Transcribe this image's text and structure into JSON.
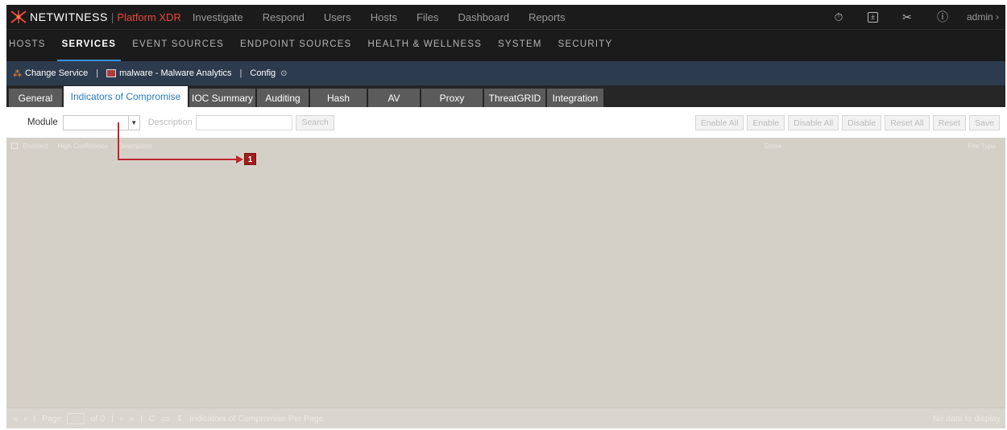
{
  "topbar": {
    "brand": "NETWITNESS",
    "platform": "Platform XDR",
    "nav": [
      "Investigate",
      "Respond",
      "Users",
      "Hosts",
      "Files",
      "Dashboard",
      "Reports"
    ],
    "icons": [
      "timer-icon",
      "calculator-icon",
      "tools-icon",
      "help-icon"
    ],
    "user": "admin"
  },
  "secnav": {
    "items": [
      "HOSTS",
      "SERVICES",
      "EVENT SOURCES",
      "ENDPOINT SOURCES",
      "HEALTH & WELLNESS",
      "SYSTEM",
      "SECURITY"
    ],
    "active": "SERVICES"
  },
  "servicebar": {
    "change_service": "Change Service",
    "service": "malware - Malware Analytics",
    "config": "Config"
  },
  "tabs": [
    "General",
    "Indicators of Compromise",
    "IOC Summary",
    "Auditing",
    "Hash",
    "AV",
    "Proxy",
    "ThreatGRID",
    "Integration"
  ],
  "active_tab": "Indicators of Compromise",
  "toolbar": {
    "module_label": "Module",
    "module_value": "",
    "description_label": "Description",
    "description_value": "",
    "search_label": "Search",
    "buttons": [
      "Enable All",
      "Enable",
      "Disable All",
      "Disable",
      "Reset All",
      "Reset",
      "Save"
    ]
  },
  "grid": {
    "columns": [
      "Enabled",
      "High Confidence",
      "Description",
      "Score",
      "File Type"
    ]
  },
  "footer": {
    "page_label": "Page",
    "page_value": "",
    "of_label": "of 0",
    "per_page_label": "Indicators of Compromise Per Page",
    "status": "No data to display"
  },
  "callout": {
    "number": "1"
  },
  "colors": {
    "accent": "#3b8fd6",
    "brand_red": "#e8483b",
    "callout_red": "#c0272d",
    "servicebar": "#2d3b4e"
  }
}
